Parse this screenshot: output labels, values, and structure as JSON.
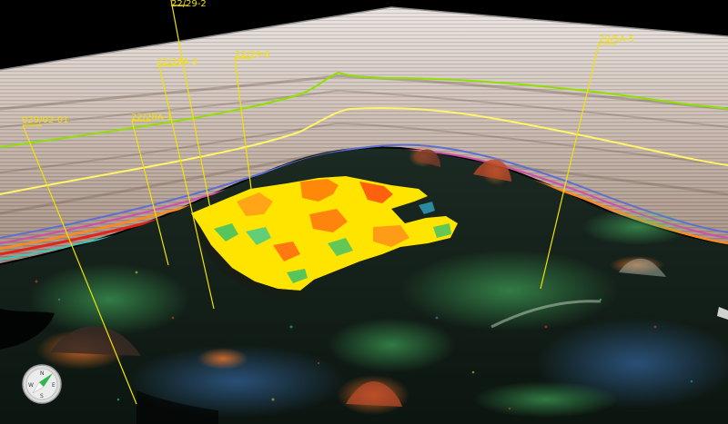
{
  "scene": {
    "wells": [
      {
        "id": "well-22-29-2",
        "label": "22/29-2"
      },
      {
        "id": "well-22-28a-3",
        "label": "22/28A-3"
      },
      {
        "id": "well-22-29-6",
        "label": "22/29-6"
      },
      {
        "id": "well-029-02-01",
        "label": "029/02-01"
      },
      {
        "id": "well-22-28a-1",
        "label": "22/28A-1"
      },
      {
        "id": "well-29-5a-5",
        "label": "29/5A-5"
      }
    ],
    "compass": {
      "north": "N",
      "south": "S",
      "east": "E",
      "west": "W"
    },
    "colors": {
      "well_line": "#f2e200",
      "horizon_green": "#8fe000",
      "horizon_yellow": "#fff46a",
      "seismic_base": "#c2b3aa",
      "attribute_high": "#ffe400"
    }
  }
}
